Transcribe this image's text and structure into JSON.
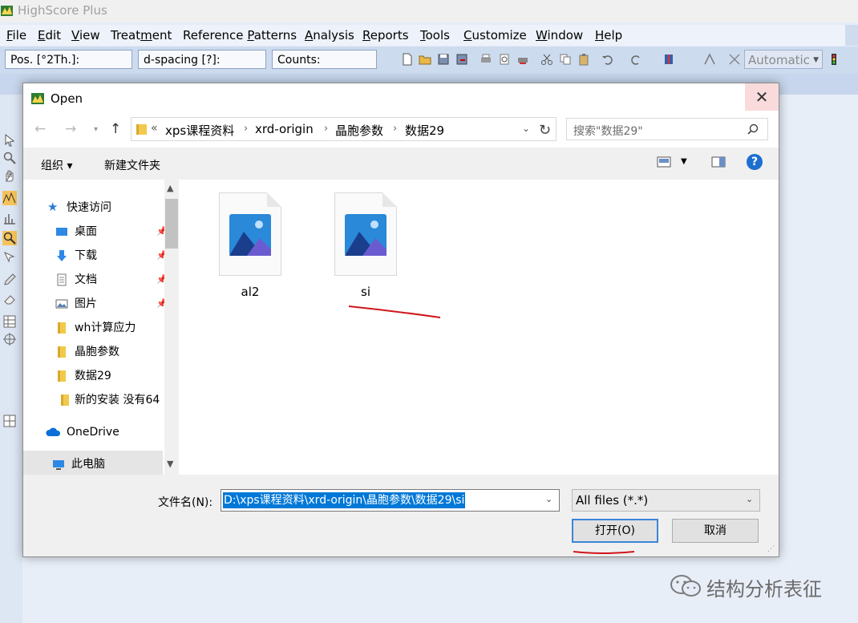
{
  "app": {
    "title": "HighScore Plus"
  },
  "menubar": {
    "items": [
      {
        "pre": "",
        "u": "F",
        "post": "ile"
      },
      {
        "pre": "",
        "u": "E",
        "post": "dit"
      },
      {
        "pre": "",
        "u": "V",
        "post": "iew"
      },
      {
        "pre": "Treat",
        "u": "m",
        "post": "ent"
      },
      {
        "pre": "Reference ",
        "u": "P",
        "post": "atterns"
      },
      {
        "pre": "",
        "u": "A",
        "post": "nalysis"
      },
      {
        "pre": "",
        "u": "R",
        "post": "eports"
      },
      {
        "pre": "",
        "u": "T",
        "post": "ools"
      },
      {
        "pre": "",
        "u": "C",
        "post": "ustomize"
      },
      {
        "pre": "",
        "u": "W",
        "post": "indow"
      },
      {
        "pre": "",
        "u": "H",
        "post": "elp"
      }
    ]
  },
  "toolbar": {
    "pos_label": "Pos. [°2Th.]:",
    "dspacing_label": "d-spacing [?]:",
    "counts_label": "Counts:",
    "automatic_label": "Automatic"
  },
  "dialog": {
    "title": "Open",
    "close_glyph": "✕",
    "address": {
      "overflow": "«",
      "crumbs": [
        "xps课程资料",
        "xrd-origin",
        "晶胞参数",
        "数据29"
      ]
    },
    "search_placeholder": "搜索\"数据29\"",
    "organize_label": "组织 ▾",
    "new_folder_label": "新建文件夹",
    "help_glyph": "?",
    "nav": {
      "quick_access": "快速访问",
      "items": [
        {
          "label": "桌面",
          "pinned": true
        },
        {
          "label": "下载",
          "pinned": true
        },
        {
          "label": "文档",
          "pinned": true
        },
        {
          "label": "图片",
          "pinned": true
        },
        {
          "label": "wh计算应力",
          "pinned": false
        },
        {
          "label": "晶胞参数",
          "pinned": false
        },
        {
          "label": "数据29",
          "pinned": false
        },
        {
          "label": "新的安装 没有64",
          "pinned": false
        }
      ],
      "onedrive": "OneDrive",
      "this_pc": "此电脑"
    },
    "files": [
      {
        "name": "al2"
      },
      {
        "name": "si"
      }
    ],
    "filename_label": "文件名(N):",
    "filename_value": "D:\\xps课程资料\\xrd-origin\\晶胞参数\\数据29\\si",
    "filter_value": "All files (*.*)",
    "open_label": "打开(O)",
    "cancel_label": "取消"
  },
  "watermark": {
    "text": "结构分析表征"
  },
  "colors": {
    "accent": "#0078d7",
    "annotation": "#d0161b"
  }
}
